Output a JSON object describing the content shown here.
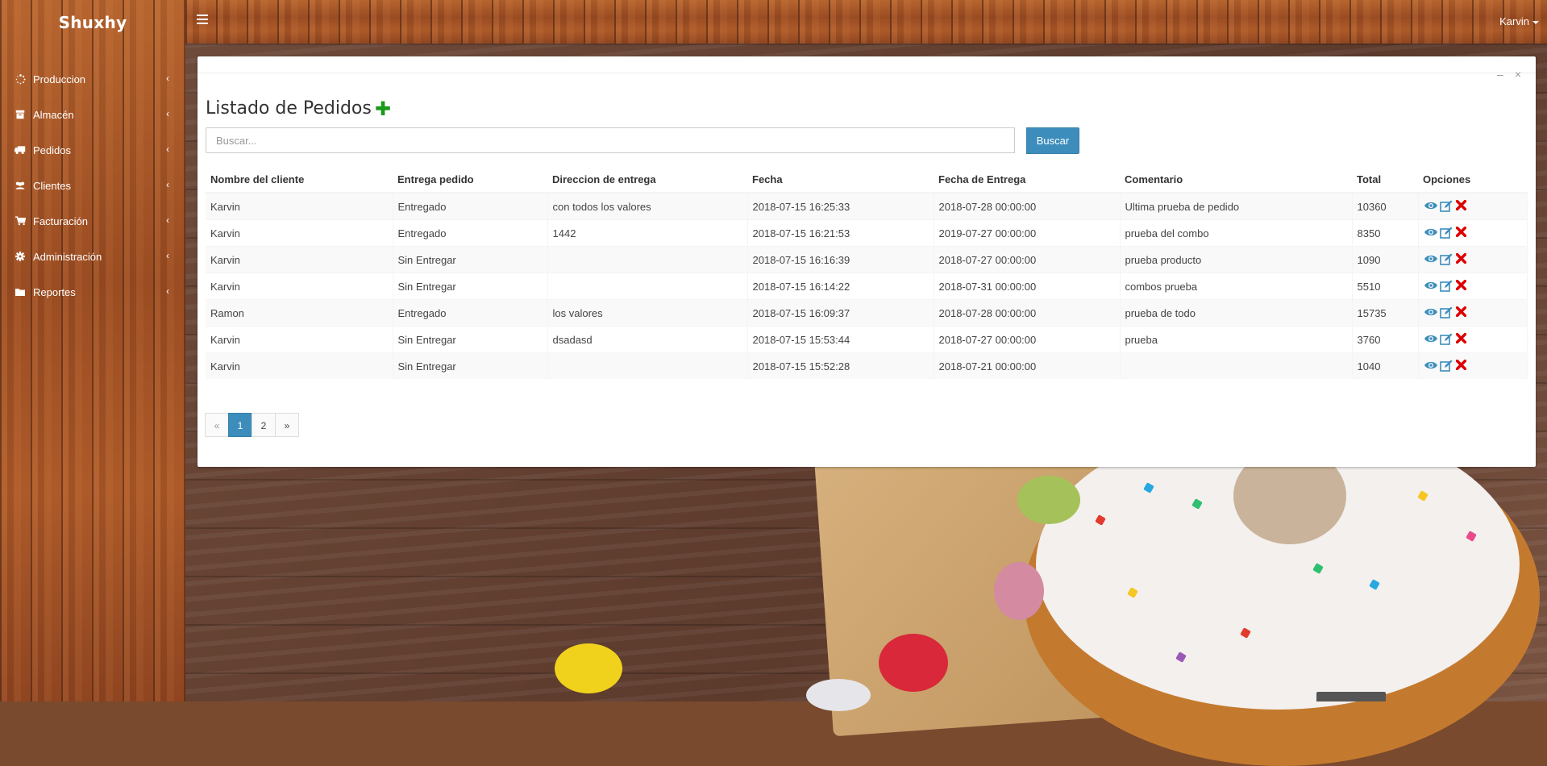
{
  "app": {
    "brand": "Shuxhy",
    "user": "Karvin"
  },
  "sidebar": {
    "items": [
      {
        "label": "Produccion",
        "icon": "spinner-icon"
      },
      {
        "label": "Almacén",
        "icon": "archive-icon"
      },
      {
        "label": "Pedidos",
        "icon": "truck-icon"
      },
      {
        "label": "Clientes",
        "icon": "users-icon"
      },
      {
        "label": "Facturación",
        "icon": "cart-icon"
      },
      {
        "label": "Administración",
        "icon": "gear-icon"
      },
      {
        "label": "Reportes",
        "icon": "folder-icon"
      }
    ]
  },
  "page": {
    "title": "Listado de Pedidos",
    "search": {
      "placeholder": "Buscar...",
      "value": "",
      "button": "Buscar"
    }
  },
  "table": {
    "headers": [
      "Nombre del cliente",
      "Entrega pedido",
      "Direccion de entrega",
      "Fecha",
      "Fecha de Entrega",
      "Comentario",
      "Total",
      "Opciones"
    ],
    "rows": [
      [
        "Karvin",
        "Entregado",
        "con todos los valores",
        "2018-07-15 16:25:33",
        "2018-07-28 00:00:00",
        "Ultima prueba de pedido",
        "10360"
      ],
      [
        "Karvin",
        "Entregado",
        "1442",
        "2018-07-15 16:21:53",
        "2019-07-27 00:00:00",
        "prueba del combo",
        "8350"
      ],
      [
        "Karvin",
        "Sin Entregar",
        "",
        "2018-07-15 16:16:39",
        "2018-07-27 00:00:00",
        "prueba producto",
        "1090"
      ],
      [
        "Karvin",
        "Sin Entregar",
        "",
        "2018-07-15 16:14:22",
        "2018-07-31 00:00:00",
        "combos prueba",
        "5510"
      ],
      [
        "Ramon",
        "Entregado",
        "los valores",
        "2018-07-15 16:09:37",
        "2018-07-28 00:00:00",
        "prueba de todo",
        "15735"
      ],
      [
        "Karvin",
        "Sin Entregar",
        "dsadasd",
        "2018-07-15 15:53:44",
        "2018-07-27 00:00:00",
        "prueba",
        "3760"
      ],
      [
        "Karvin",
        "Sin Entregar",
        "",
        "2018-07-15 15:52:28",
        "2018-07-21 00:00:00",
        "",
        "1040"
      ]
    ],
    "row_actions": [
      "eye-icon",
      "edit-icon",
      "delete-icon"
    ]
  },
  "pagination": {
    "prev": "«",
    "pages": [
      "1",
      "2"
    ],
    "current": "1",
    "next": "»"
  },
  "colors": {
    "accent": "#3c8dbc",
    "add": "#1a9a1a",
    "delete": "#dd0000"
  }
}
